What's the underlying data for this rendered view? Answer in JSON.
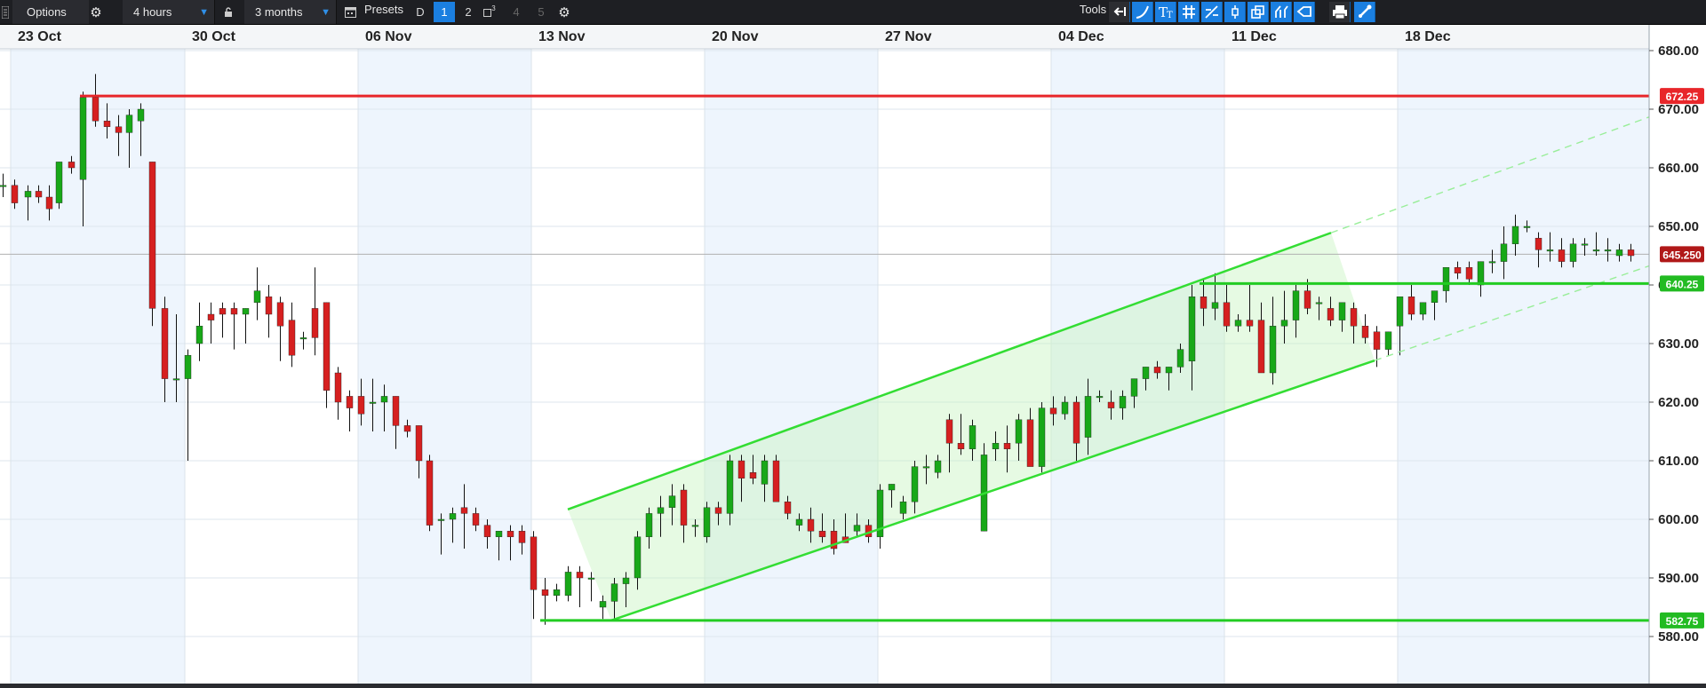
{
  "toolbar": {
    "options_label": "Options",
    "interval_value": "4 hours",
    "range_value": "3 months",
    "presets_label": "Presets",
    "preset_d": "D",
    "preset_1": "1",
    "preset_2": "2",
    "preset_3_sup": "3",
    "preset_4": "4",
    "preset_5": "5",
    "tools_label": "Tools",
    "tool_icons": [
      "back-arrow-icon",
      "curve-line-icon",
      "text-tool-icon",
      "grid-icon",
      "draw-line-icon",
      "vertical-line-icon",
      "layers-icon",
      "fork-icon",
      "tag-icon",
      "print-icon",
      "settings-brush-icon"
    ]
  },
  "chart_data": {
    "type": "candlestick",
    "x_labels": [
      "23 Oct",
      "30 Oct",
      "06 Nov",
      "13 Nov",
      "20 Nov",
      "27 Nov",
      "04 Dec",
      "11 Dec",
      "18 Dec"
    ],
    "y_ticks": [
      "680.00",
      "670.00",
      "660.00",
      "650.00",
      "640.00",
      "630.00",
      "620.00",
      "610.00",
      "600.00",
      "590.00",
      "580.00"
    ],
    "ylim": [
      576.3,
      683.5
    ],
    "price_badges": {
      "resistance": "672.25",
      "current": "645.250",
      "support_mid": "640.25",
      "support_low": "582.75"
    },
    "horizontal_lines": [
      {
        "name": "resistance",
        "value": 672.25,
        "color": "#e8262a"
      },
      {
        "name": "support-mid",
        "value": 640.25,
        "color": "#22cc22"
      },
      {
        "name": "support-low",
        "value": 582.75,
        "color": "#22cc22"
      },
      {
        "name": "current-price",
        "value": 645.25,
        "color": "#b0b0b0"
      }
    ],
    "channel": {
      "upper": [
        [
          639,
          601.7
        ],
        [
          1498,
          648.9
        ]
      ],
      "lower": [
        [
          688,
          582.75
        ],
        [
          1547,
          627.1
        ]
      ],
      "extension_upper": [
        [
          1498,
          648.9
        ],
        [
          1920,
          672.2
        ]
      ],
      "extension_lower": [
        [
          1547,
          627.1
        ],
        [
          1920,
          646.6
        ]
      ]
    },
    "candles": [
      [
        0,
        657,
        659,
        655,
        657
      ],
      [
        13,
        657,
        658,
        653,
        654
      ],
      [
        28,
        655,
        657,
        651,
        656
      ],
      [
        40,
        656,
        657,
        654,
        655
      ],
      [
        52,
        655,
        657,
        651,
        653
      ],
      [
        63,
        654,
        661,
        653,
        661
      ],
      [
        77,
        661,
        662,
        659,
        660
      ],
      [
        90,
        658,
        673,
        650,
        672
      ],
      [
        104,
        672,
        676,
        667,
        668
      ],
      [
        117,
        668,
        671,
        665,
        667
      ],
      [
        130,
        667,
        669,
        662,
        666
      ],
      [
        142,
        666,
        670,
        660,
        669
      ],
      [
        155,
        668,
        671,
        662,
        670
      ],
      [
        168,
        661,
        661,
        633,
        636
      ],
      [
        182,
        636,
        638,
        620,
        624
      ],
      [
        195,
        624,
        635,
        620,
        624
      ],
      [
        208,
        624,
        629,
        610,
        628
      ],
      [
        221,
        630,
        637,
        627,
        633
      ],
      [
        234,
        635,
        637,
        630,
        634
      ],
      [
        247,
        636,
        637,
        631,
        635
      ],
      [
        260,
        636,
        637,
        629,
        635
      ],
      [
        273,
        635,
        636,
        630,
        636
      ],
      [
        286,
        637,
        643,
        634,
        639
      ],
      [
        299,
        638,
        640,
        631,
        635
      ],
      [
        312,
        637,
        638,
        627,
        633
      ],
      [
        325,
        634,
        637,
        626,
        628
      ],
      [
        338,
        631,
        632,
        629,
        631
      ],
      [
        351,
        636,
        643,
        628,
        631
      ],
      [
        364,
        637,
        637,
        619,
        622
      ],
      [
        377,
        625,
        626,
        617,
        620
      ],
      [
        390,
        621,
        622,
        615,
        619
      ],
      [
        403,
        621,
        624,
        616,
        618
      ],
      [
        416,
        620,
        624,
        615,
        620
      ],
      [
        429,
        620,
        623,
        615,
        621
      ],
      [
        442,
        621,
        621,
        612,
        616
      ],
      [
        455,
        616,
        617,
        614,
        615
      ],
      [
        468,
        616,
        616,
        607,
        610
      ],
      [
        480,
        610,
        611,
        598,
        599
      ],
      [
        493,
        600,
        601,
        594,
        600
      ],
      [
        506,
        600,
        602,
        596,
        601
      ],
      [
        519,
        602,
        606,
        595,
        601
      ],
      [
        532,
        601,
        602,
        598,
        599
      ],
      [
        545,
        599,
        600,
        595,
        597
      ],
      [
        558,
        597,
        598,
        593,
        598
      ],
      [
        571,
        598,
        599,
        593,
        597
      ],
      [
        584,
        598,
        599,
        594,
        596
      ],
      [
        597,
        597,
        598,
        583,
        588
      ],
      [
        610,
        588,
        590,
        582,
        587
      ],
      [
        623,
        587,
        589,
        586,
        588
      ],
      [
        636,
        587,
        592,
        586,
        591
      ],
      [
        649,
        591,
        592,
        585,
        590
      ],
      [
        662,
        590,
        591,
        586,
        590
      ],
      [
        675,
        585,
        587,
        583,
        586
      ],
      [
        688,
        586,
        590,
        583,
        589
      ],
      [
        701,
        589,
        591,
        585,
        590
      ],
      [
        714,
        590,
        598,
        588,
        597
      ],
      [
        727,
        597,
        602,
        595,
        601
      ],
      [
        740,
        601,
        604,
        597,
        602
      ],
      [
        753,
        602,
        606,
        599,
        604
      ],
      [
        766,
        605,
        606,
        596,
        599
      ],
      [
        779,
        599,
        600,
        597,
        599
      ],
      [
        792,
        597,
        603,
        596,
        602
      ],
      [
        805,
        602,
        603,
        599,
        601
      ],
      [
        818,
        601,
        611,
        599,
        610
      ],
      [
        831,
        610,
        611,
        603,
        607
      ],
      [
        844,
        608,
        611,
        606,
        607
      ],
      [
        857,
        606,
        611,
        603,
        610
      ],
      [
        870,
        610,
        611,
        605,
        603
      ],
      [
        883,
        603,
        604,
        600,
        601
      ],
      [
        896,
        599,
        601,
        598,
        600
      ],
      [
        909,
        600,
        602,
        596,
        598
      ],
      [
        922,
        598,
        601,
        596,
        597
      ],
      [
        935,
        598,
        600,
        594,
        595
      ],
      [
        948,
        597,
        601,
        596,
        596
      ],
      [
        961,
        598,
        601,
        597,
        599
      ],
      [
        974,
        599,
        600,
        596,
        597
      ],
      [
        987,
        597,
        606,
        595,
        605
      ],
      [
        1000,
        605,
        606,
        602,
        606
      ],
      [
        1013,
        601,
        604,
        600,
        603
      ],
      [
        1026,
        603,
        610,
        601,
        609
      ],
      [
        1039,
        609,
        611,
        606,
        609
      ],
      [
        1052,
        608,
        611,
        607,
        610
      ],
      [
        1065,
        617,
        618,
        608,
        613
      ],
      [
        1078,
        613,
        618,
        611,
        612
      ],
      [
        1091,
        612,
        617,
        610,
        616
      ],
      [
        1104,
        598,
        613,
        598,
        611
      ],
      [
        1117,
        612,
        615,
        610,
        613
      ],
      [
        1130,
        613,
        616,
        608,
        612
      ],
      [
        1143,
        613,
        618,
        610,
        617
      ],
      [
        1156,
        617,
        619,
        612,
        609
      ],
      [
        1169,
        609,
        620,
        608,
        619
      ],
      [
        1182,
        619,
        621,
        616,
        618
      ],
      [
        1195,
        618,
        621,
        617,
        620
      ],
      [
        1208,
        620,
        621,
        610,
        613
      ],
      [
        1221,
        614,
        624,
        611,
        621
      ],
      [
        1234,
        621,
        622,
        620,
        621
      ],
      [
        1247,
        620,
        622,
        617,
        619
      ],
      [
        1260,
        619,
        622,
        617,
        621
      ],
      [
        1273,
        621,
        624,
        619,
        624
      ],
      [
        1286,
        624,
        626,
        622,
        626
      ],
      [
        1299,
        626,
        627,
        624,
        625
      ],
      [
        1312,
        625,
        626,
        622,
        626
      ],
      [
        1325,
        626,
        630,
        625,
        629
      ],
      [
        1338,
        627,
        640,
        622,
        638
      ],
      [
        1351,
        638,
        641,
        633,
        636
      ],
      [
        1364,
        636,
        642,
        634,
        637
      ],
      [
        1377,
        637,
        640,
        632,
        633
      ],
      [
        1390,
        633,
        635,
        632,
        634
      ],
      [
        1403,
        634,
        640,
        632,
        633
      ],
      [
        1416,
        634,
        637,
        626,
        625
      ],
      [
        1429,
        625,
        638,
        623,
        633
      ],
      [
        1442,
        633,
        639,
        630,
        634
      ],
      [
        1455,
        634,
        640,
        631,
        639
      ],
      [
        1468,
        639,
        641,
        635,
        636
      ],
      [
        1481,
        637,
        638,
        634,
        637
      ],
      [
        1494,
        636,
        638,
        633,
        634
      ],
      [
        1507,
        634,
        636,
        632,
        637
      ],
      [
        1520,
        636,
        637,
        630,
        633
      ],
      [
        1533,
        633,
        635,
        630,
        631
      ],
      [
        1546,
        632,
        633,
        626,
        629
      ],
      [
        1559,
        629,
        632,
        628,
        632
      ],
      [
        1572,
        633,
        636,
        628,
        638
      ],
      [
        1585,
        638,
        640,
        634,
        635
      ],
      [
        1598,
        635,
        637,
        634,
        637
      ],
      [
        1611,
        637,
        639,
        634,
        639
      ],
      [
        1624,
        639,
        643,
        637,
        643
      ],
      [
        1637,
        643,
        644,
        641,
        642
      ],
      [
        1650,
        643,
        644,
        640,
        641
      ],
      [
        1663,
        640,
        644,
        638,
        644
      ],
      [
        1676,
        644,
        646,
        642,
        644
      ],
      [
        1689,
        644,
        650,
        641,
        647
      ],
      [
        1702,
        647,
        652,
        645,
        650
      ],
      [
        1715,
        650,
        651,
        649,
        650
      ],
      [
        1728,
        648,
        649,
        643,
        646
      ],
      [
        1741,
        646,
        649,
        644,
        646
      ],
      [
        1754,
        646,
        648,
        643,
        644
      ],
      [
        1767,
        644,
        648,
        643,
        647
      ],
      [
        1780,
        647,
        648,
        645,
        647
      ],
      [
        1793,
        646,
        649,
        645,
        646
      ],
      [
        1806,
        646,
        648,
        644,
        646
      ],
      [
        1819,
        645,
        647,
        644,
        646
      ],
      [
        1832,
        646,
        647,
        644,
        645
      ]
    ]
  }
}
